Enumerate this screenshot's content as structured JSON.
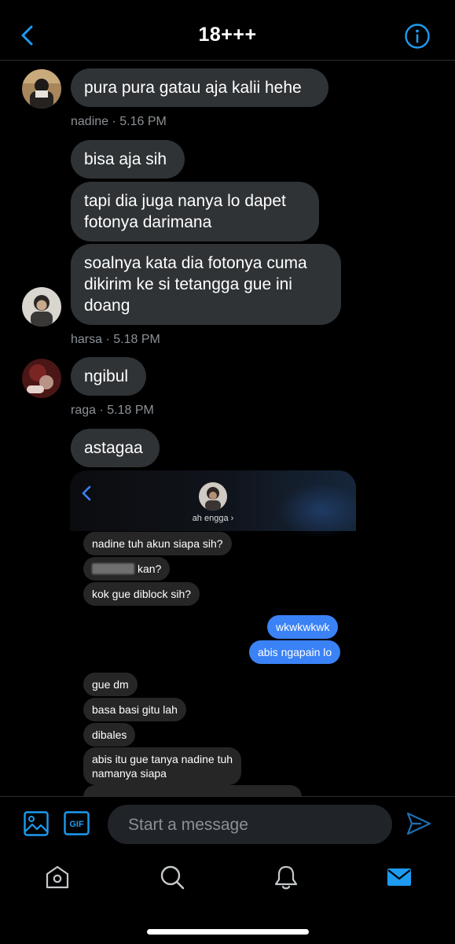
{
  "header": {
    "title": "18+++"
  },
  "messages": [
    {
      "text": "pura pura gatau aja kalii hehe"
    },
    {
      "text": "bisa aja sih"
    },
    {
      "text": "tapi dia juga nanya lo dapet\nfotonya darimana"
    },
    {
      "text": "soalnya kata dia fotonya cuma\ndikirim ke si tetangga gue ini\ndoang"
    },
    {
      "text": "ngibul"
    },
    {
      "text": "astagaa"
    }
  ],
  "meta": [
    {
      "text": "nadine · 5.16 PM"
    },
    {
      "text": "harsa · 5.18 PM"
    },
    {
      "text": "raga · 5.18 PM"
    }
  ],
  "screenshot": {
    "contact_name": "ah engga ›",
    "messages": [
      {
        "text": "nadine tuh akun siapa sih?"
      },
      {
        "text": "kan?"
      },
      {
        "text": "kok gue diblock sih?"
      },
      {
        "text": "wkwkwkwk"
      },
      {
        "text": "abis ngapain lo"
      },
      {
        "text": "gue dm"
      },
      {
        "text": "basa basi gitu lah"
      },
      {
        "text": "dibales"
      },
      {
        "text": "abis itu gue tanya nadine tuh\nnamanya siapa"
      }
    ]
  },
  "composer": {
    "placeholder": "Start a message",
    "gif_label": "GIF"
  },
  "nav": {
    "items": [
      "home-icon",
      "search-icon",
      "notifications-icon",
      "messages-icon"
    ]
  },
  "colors": {
    "accent": "#1d9bf0",
    "bubble": "#2f3336",
    "outgoing": "#3b82f6"
  }
}
